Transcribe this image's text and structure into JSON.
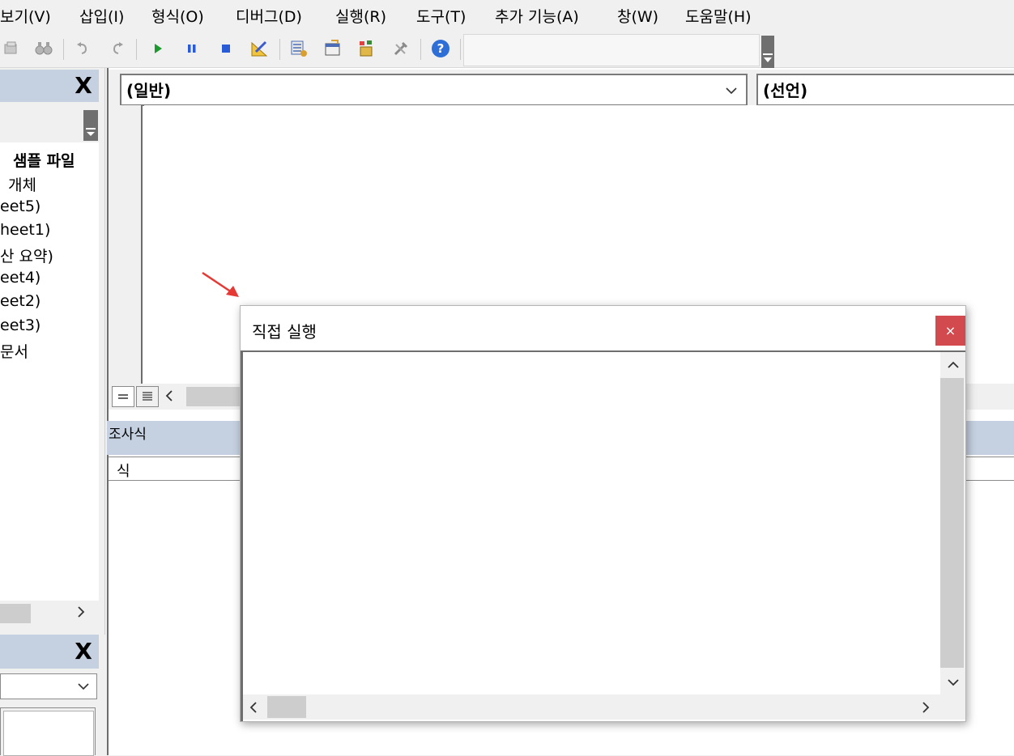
{
  "menu": {
    "items": [
      {
        "label": "보기(V)"
      },
      {
        "label": "삽입(I)"
      },
      {
        "label": "형식(O)"
      },
      {
        "label": "디버그(D)"
      },
      {
        "label": "실행(R)"
      },
      {
        "label": "도구(T)"
      },
      {
        "label": "추가 기능(A)"
      },
      {
        "label": "창(W)"
      },
      {
        "label": "도움말(H)"
      }
    ]
  },
  "toolbar": {
    "icons": [
      "find-icon",
      "binoculars-icon",
      "undo-icon",
      "redo-icon",
      "run-icon",
      "pause-icon",
      "stop-icon",
      "design-mode-icon",
      "project-explorer-icon",
      "properties-window-icon",
      "object-browser-icon",
      "toolbox-icon",
      "help-icon"
    ]
  },
  "project_pane": {
    "close_label": "X",
    "items": [
      {
        "label": "샘플 파일"
      },
      {
        "label": "개체"
      },
      {
        "label": "eet5)"
      },
      {
        "label": "heet1)"
      },
      {
        "label": "산 요약)"
      },
      {
        "label": "eet4)"
      },
      {
        "label": "eet2)"
      },
      {
        "label": "eet3)"
      },
      {
        "label": "문서"
      }
    ]
  },
  "properties_pane": {
    "close_label": "X"
  },
  "code_window": {
    "object_combo": "(일반)",
    "procedure_combo": "(선언)"
  },
  "watch_pane": {
    "title": "조사식",
    "column_header": "식"
  },
  "immediate_window": {
    "title": "직접 실행",
    "close_label": "×"
  },
  "colors": {
    "pane_title": "#c5d1e0",
    "close_button": "#d24a4d",
    "arrow": "#e53935"
  }
}
